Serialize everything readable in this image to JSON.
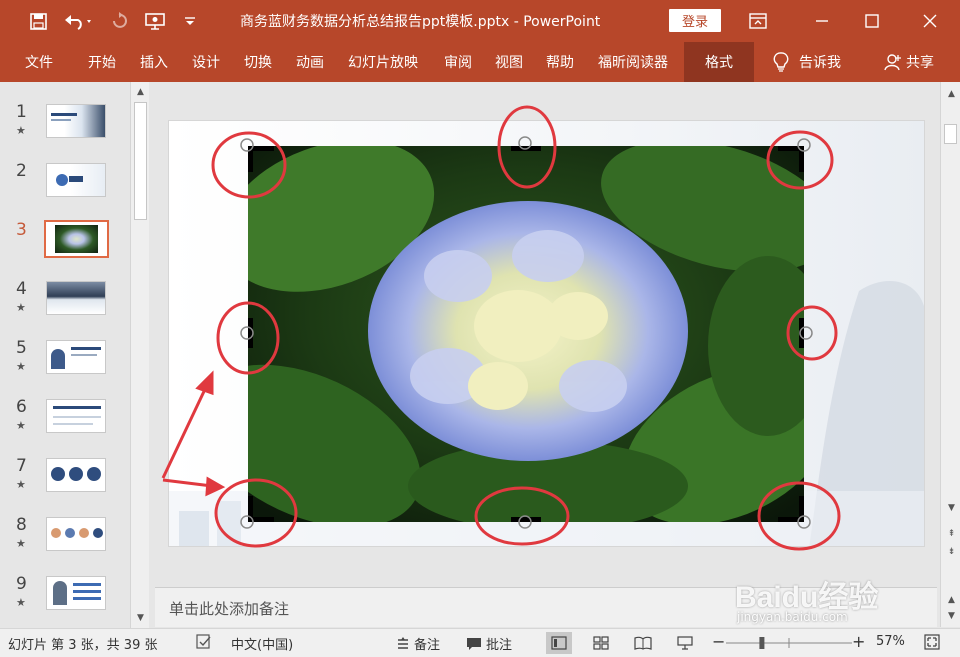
{
  "titlebar": {
    "doc_title": "商务蓝财务数据分析总结报告ppt模板.pptx  -  PowerPoint",
    "login_label": "登录"
  },
  "ribbon": {
    "tabs": [
      "文件",
      "开始",
      "插入",
      "设计",
      "切换",
      "动画",
      "幻灯片放映",
      "审阅",
      "视图",
      "帮助",
      "福昕阅读器",
      "格式"
    ],
    "active_tab": "格式",
    "tell_me": "告诉我",
    "share": "共享"
  },
  "slides_panel": {
    "items": [
      {
        "num": "1",
        "star": "★"
      },
      {
        "num": "2",
        "star": ""
      },
      {
        "num": "3",
        "star": ""
      },
      {
        "num": "4",
        "star": "★"
      },
      {
        "num": "5",
        "star": "★"
      },
      {
        "num": "6",
        "star": "★"
      },
      {
        "num": "7",
        "star": "★"
      },
      {
        "num": "8",
        "star": "★"
      },
      {
        "num": "9",
        "star": "★"
      }
    ],
    "current": "3"
  },
  "notes": {
    "placeholder": "单击此处添加备注"
  },
  "statusbar": {
    "slide_info": "幻灯片 第 3 张，共 39 张",
    "language": "中文(中国)",
    "notes_label": "备注",
    "comments_label": "批注",
    "zoom": "57%",
    "zoom_level": 0.57
  },
  "watermark": {
    "brand": "Baidu经验",
    "url": "jingyan.baidu.com"
  },
  "colors": {
    "accent": "#b7472a",
    "active_tab": "#8f3520",
    "annotation": "#e0393f"
  },
  "icons": [
    "save-icon",
    "undo-icon",
    "redo-icon",
    "present-icon",
    "customize-icon",
    "ribbon-options-icon",
    "minimize-icon",
    "maximize-icon",
    "close-icon",
    "lightbulb-icon",
    "user-icon",
    "notes-icon",
    "comment-icon",
    "normal-view-icon",
    "slide-sorter-icon",
    "reading-view-icon",
    "slideshow-icon",
    "fit-window-icon"
  ]
}
